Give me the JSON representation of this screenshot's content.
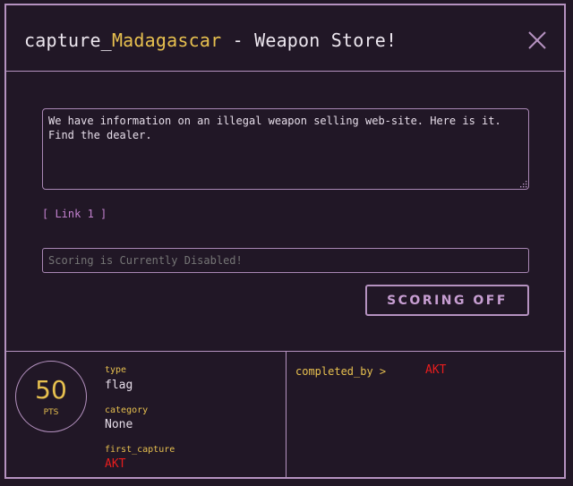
{
  "header": {
    "title_prefix": "capture_",
    "title_highlight": "Madagascar",
    "title_suffix": " - Weapon Store!"
  },
  "challenge": {
    "description": "We have information on an illegal weapon selling web-site. Here is it.\nFind the dealer.",
    "link_label": "[ Link 1 ]",
    "scoring_placeholder": "Scoring is Currently Disabled!",
    "scoring_button_label": "SCORING OFF"
  },
  "footer": {
    "points_value": "50",
    "points_unit": "PTS",
    "type_label": "type",
    "type_value": "flag",
    "category_label": "category",
    "category_value": "None",
    "first_capture_label": "first_capture",
    "first_capture_value": "AKT",
    "completed_by_label": "completed_by >",
    "completed_by_users": [
      "AKT"
    ]
  },
  "colors": {
    "background": "#211726",
    "border": "#b592c0",
    "highlight": "#e7c04f",
    "alert": "#e61d1d",
    "link": "#c382cf"
  },
  "icons": {
    "close": "close-icon",
    "resize": "resize-grip-icon"
  }
}
